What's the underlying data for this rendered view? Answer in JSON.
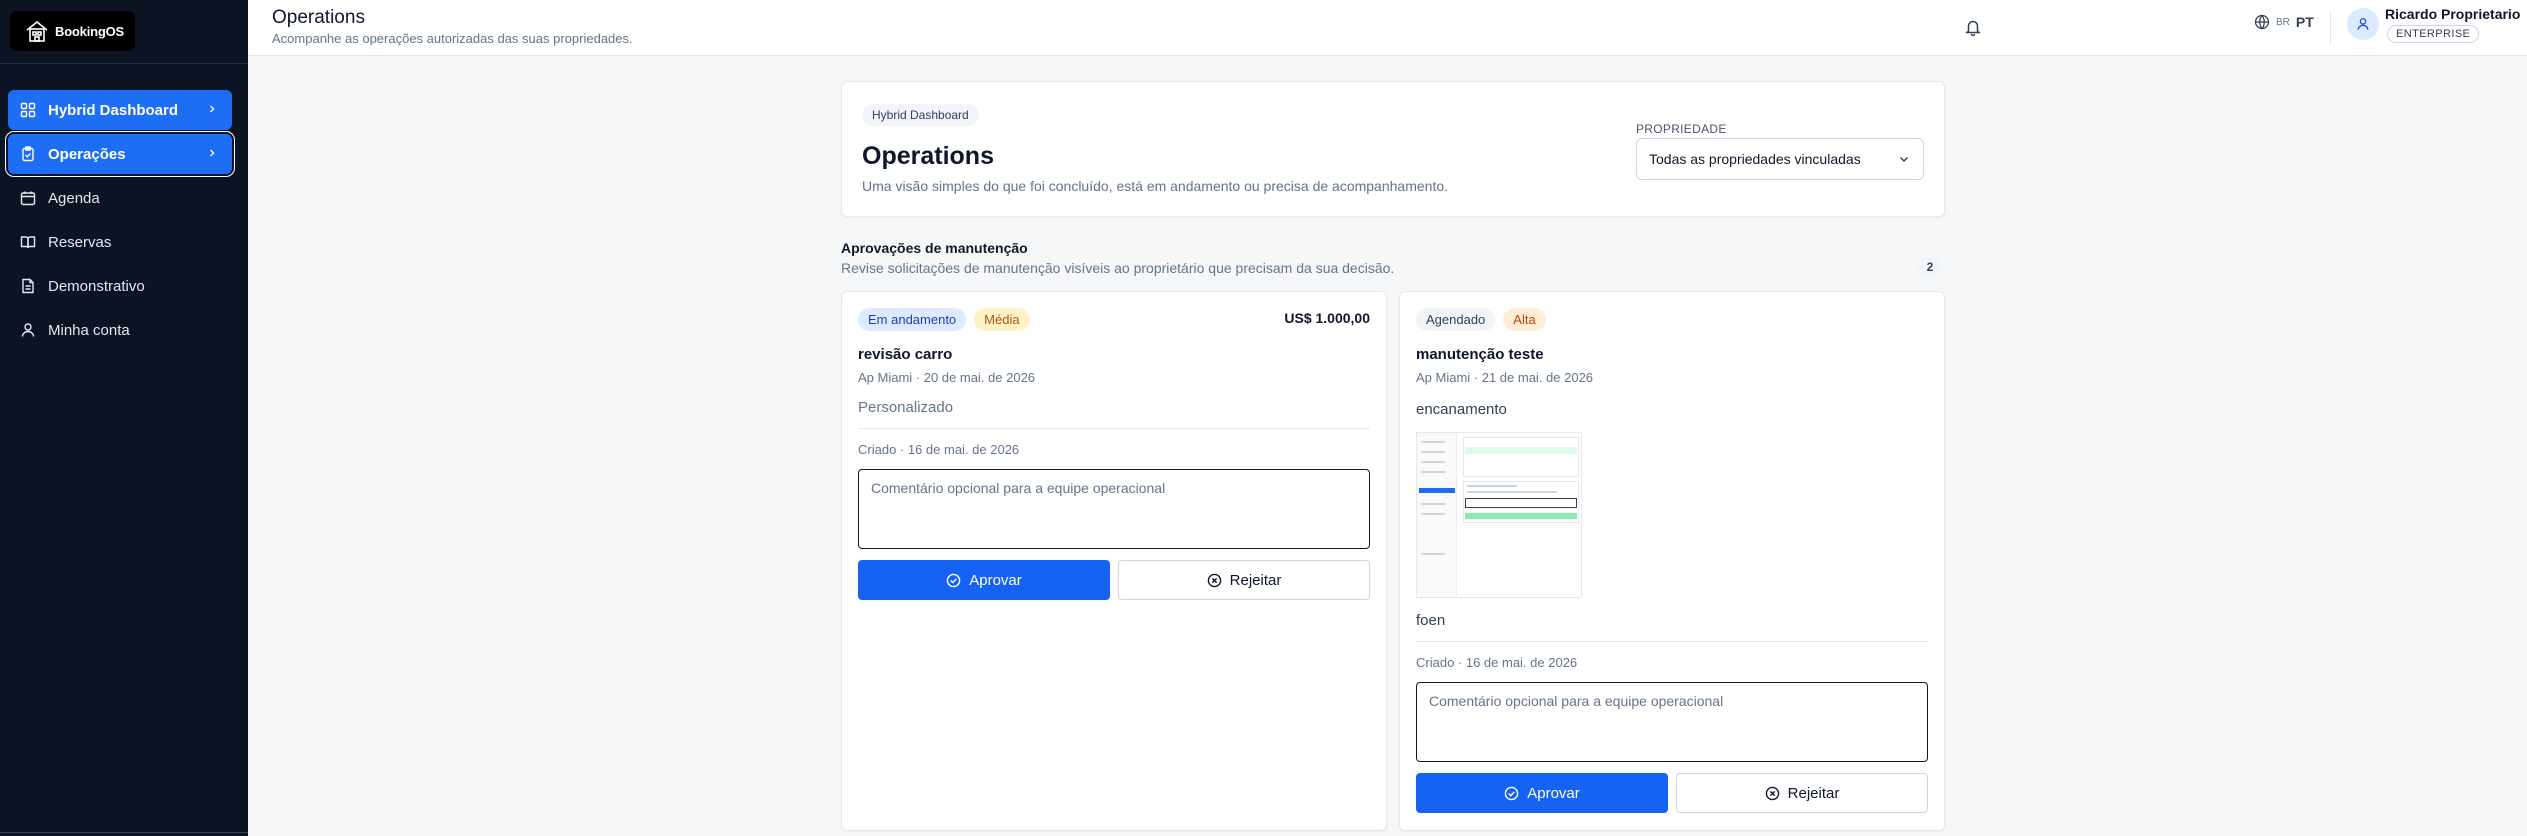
{
  "brand": {
    "name": "BookingOS"
  },
  "sidebar": {
    "items": [
      {
        "label": "Hybrid Dashboard",
        "icon": "dashboard-grid-icon"
      },
      {
        "label": "Operações",
        "icon": "clipboard-icon"
      },
      {
        "label": "Agenda",
        "icon": "calendar-icon"
      },
      {
        "label": "Reservas",
        "icon": "book-icon"
      },
      {
        "label": "Demonstrativo",
        "icon": "document-icon"
      },
      {
        "label": "Minha conta",
        "icon": "user-icon"
      }
    ]
  },
  "header": {
    "title": "Operations",
    "subtitle": "Acompanhe as operações autorizadas das suas propriedades.",
    "lang_flag": "BR",
    "lang_code": "PT",
    "user_name": "Ricardo Proprietario",
    "user_plan": "ENTERPRISE"
  },
  "panel": {
    "chip": "Hybrid Dashboard",
    "heading": "Operations",
    "description": "Uma visão simples do que foi concluído, está em andamento ou precisa de acompanhamento.",
    "property_label": "PROPRIEDADE",
    "property_value": "Todas as propriedades vinculadas"
  },
  "section": {
    "title": "Aprovações de manutenção",
    "description": "Revise solicitações de manutenção visíveis ao proprietário que precisam da sua decisão.",
    "count": "2"
  },
  "cards": [
    {
      "status": "Em andamento",
      "priority": "Média",
      "amount": "US$ 1.000,00",
      "title": "revisão carro",
      "meta": "Ap Miami · 20 de mai. de 2026",
      "type": "Personalizado",
      "created": "Criado · 16 de mai. de 2026",
      "comment_placeholder": "Comentário opcional para a equipe operacional",
      "approve": "Aprovar",
      "reject": "Rejeitar"
    },
    {
      "status": "Agendado",
      "priority": "Alta",
      "title": "manutenção teste",
      "meta": "Ap Miami · 21 de mai. de 2026",
      "description": "encanamento",
      "note": "foen",
      "created": "Criado · 16 de mai. de 2026",
      "comment_placeholder": "Comentário opcional para a equipe operacional",
      "approve": "Aprovar",
      "reject": "Rejeitar"
    }
  ],
  "colors": {
    "sidebar_bg": "#0c1424",
    "accent": "#1d6ef5",
    "approve_button": "#1663f3"
  }
}
